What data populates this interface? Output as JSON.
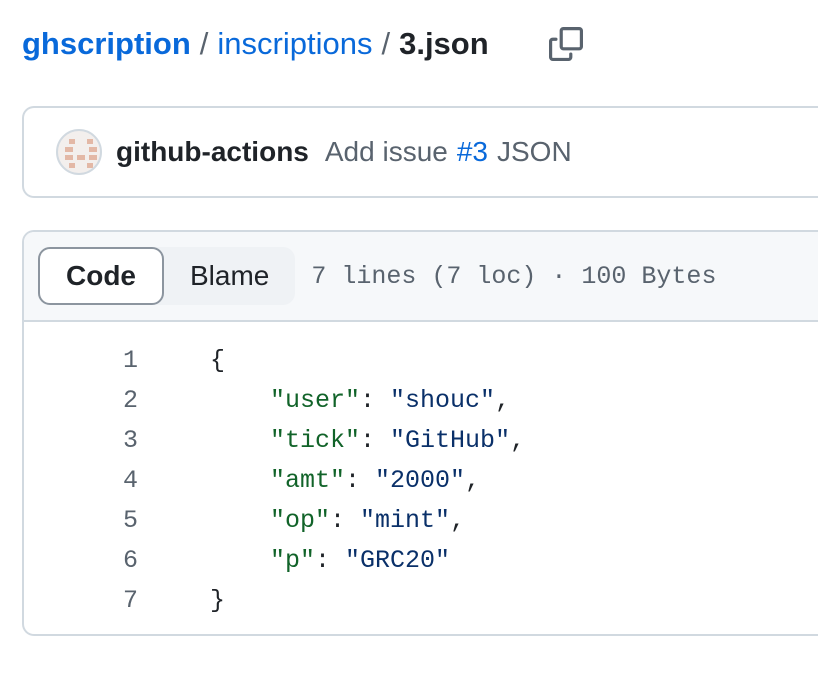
{
  "breadcrumb": {
    "repo": "ghscription",
    "separator": "/",
    "folder": "inscriptions",
    "file": "3.json"
  },
  "icons": {
    "copy": "copy-icon",
    "avatar": "github-actions-avatar"
  },
  "commit": {
    "author": "github-actions",
    "message_prefix": "Add issue",
    "issue_link": "#3",
    "message_suffix": "JSON"
  },
  "file_header": {
    "tabs": [
      {
        "label": "Code",
        "active": true
      },
      {
        "label": "Blame",
        "active": false
      }
    ],
    "info": "7 lines (7 loc) · 100 Bytes"
  },
  "code": {
    "lines": [
      {
        "n": "1",
        "text": "{"
      },
      {
        "n": "2",
        "key": "\"user\"",
        "value": "\"shouc\"",
        "comma": ","
      },
      {
        "n": "3",
        "key": "\"tick\"",
        "value": "\"GitHub\"",
        "comma": ","
      },
      {
        "n": "4",
        "key": "\"amt\"",
        "value": "\"2000\"",
        "comma": ","
      },
      {
        "n": "5",
        "key": "\"op\"",
        "value": "\"mint\"",
        "comma": ","
      },
      {
        "n": "6",
        "key": "\"p\"",
        "value": "\"GRC20\"",
        "comma": ""
      },
      {
        "n": "7",
        "text": "}"
      }
    ]
  },
  "colors": {
    "link": "#0969da",
    "json_key": "#116329",
    "json_string": "#0a3069",
    "muted": "#59636e"
  }
}
